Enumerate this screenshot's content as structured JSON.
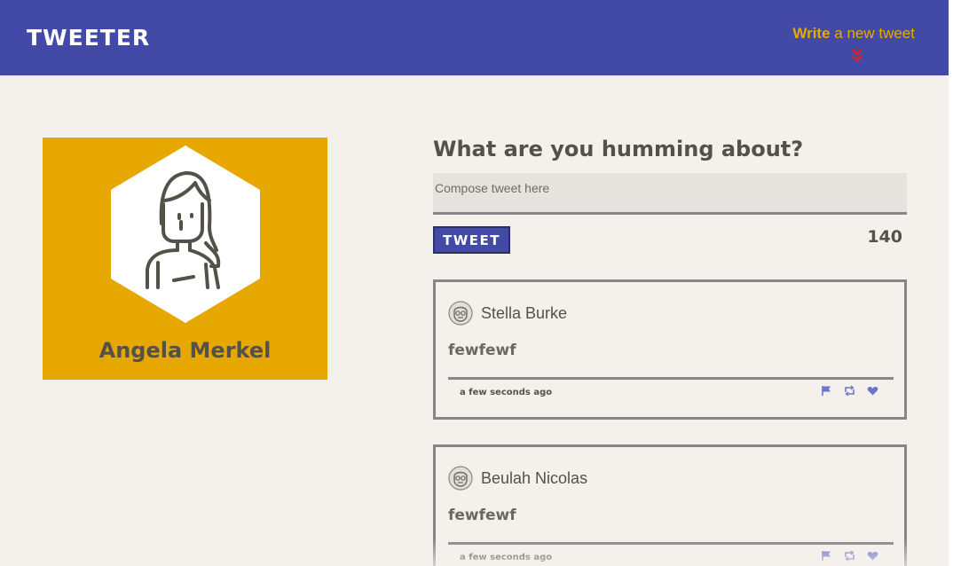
{
  "nav": {
    "logo": "TWEETER",
    "compose_toggle_bold": "Write",
    "compose_toggle_rest": " a new tweet",
    "toggle_icon": "double-chevron-down-icon"
  },
  "profile": {
    "name": "Angela Merkel",
    "avatar_icon": "user-avatar-icon",
    "background_color": "#e6a800"
  },
  "compose": {
    "title": "What are you humming about?",
    "placeholder": "Compose tweet here",
    "value": "",
    "submit_label": "TWEET",
    "counter": "140"
  },
  "tweets": [
    {
      "author": "Stella Burke",
      "content": "fewfewf",
      "time": "a few seconds ago",
      "actions": [
        "flag-icon",
        "retweet-icon",
        "heart-icon"
      ]
    },
    {
      "author": "Beulah Nicolas",
      "content": "fewfewf",
      "time": "a few seconds ago",
      "actions": [
        "flag-icon",
        "retweet-icon",
        "heart-icon"
      ]
    }
  ],
  "colors": {
    "nav": "#4349a6",
    "accent": "#e9a900",
    "background": "#f4f1ec",
    "text": "#545149",
    "border": "#868686",
    "action_icons": "#6d74c9"
  }
}
